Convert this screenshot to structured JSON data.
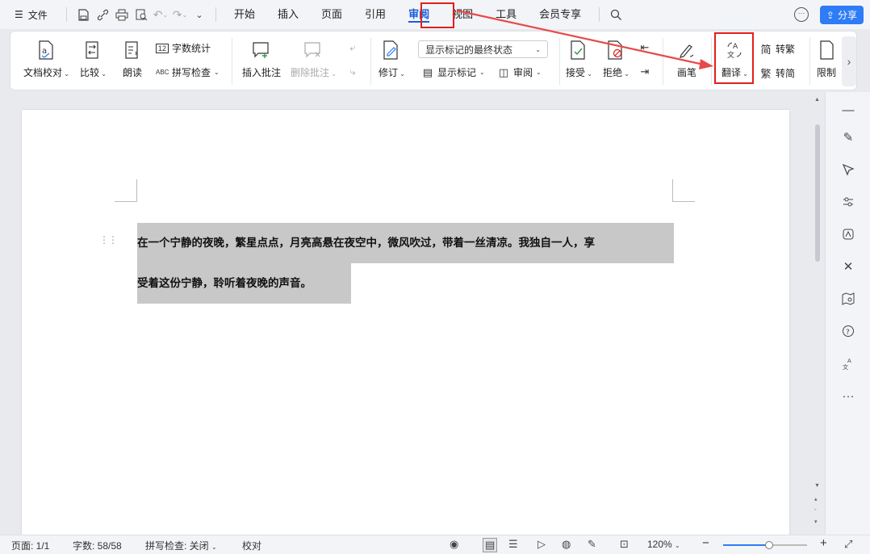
{
  "menubar": {
    "file_label": "文件",
    "tabs": [
      {
        "label": "开始"
      },
      {
        "label": "插入"
      },
      {
        "label": "页面"
      },
      {
        "label": "引用"
      },
      {
        "label": "审阅"
      },
      {
        "label": "视图"
      },
      {
        "label": "工具"
      },
      {
        "label": "会员专享"
      }
    ],
    "active_tab": "审阅",
    "share_label": "分享"
  },
  "ribbon": {
    "doc_proofread": "文档校对",
    "compare": "比较",
    "read_aloud": "朗读",
    "word_count": "字数统计",
    "spell_check": "拼写检查",
    "insert_comment": "插入批注",
    "delete_comment": "删除批注",
    "revise": "修订",
    "markup_state": "显示标记的最终状态",
    "show_markup": "显示标记",
    "review": "审阅",
    "accept": "接受",
    "reject": "拒绝",
    "pen": "画笔",
    "translate": "翻译",
    "to_traditional": "转繁",
    "to_simplified": "转简",
    "restrict": "限制",
    "spell_prefix": "ABC",
    "count_prefix": "12",
    "trad_glyph": "繁",
    "simp_glyph": "简"
  },
  "document": {
    "line1": "在一个宁静的夜晚，繁星点点，月亮高悬在夜空中，微风吹过，带着一丝清凉。我独自一人，享",
    "line2": "受着这份宁静，聆听着夜晚的声音。"
  },
  "statusbar": {
    "page": "页面: 1/1",
    "word_count": "字数: 58/58",
    "spell_check": "拼写检查: 关闭",
    "proofread": "校对",
    "zoom": "120%",
    "zoom_fraction": 0.55
  },
  "colors": {
    "accent": "#1a5fd8",
    "highlight_box": "#e0201b",
    "share_button": "#2e7cf6",
    "selection": "#c8c8c8"
  }
}
